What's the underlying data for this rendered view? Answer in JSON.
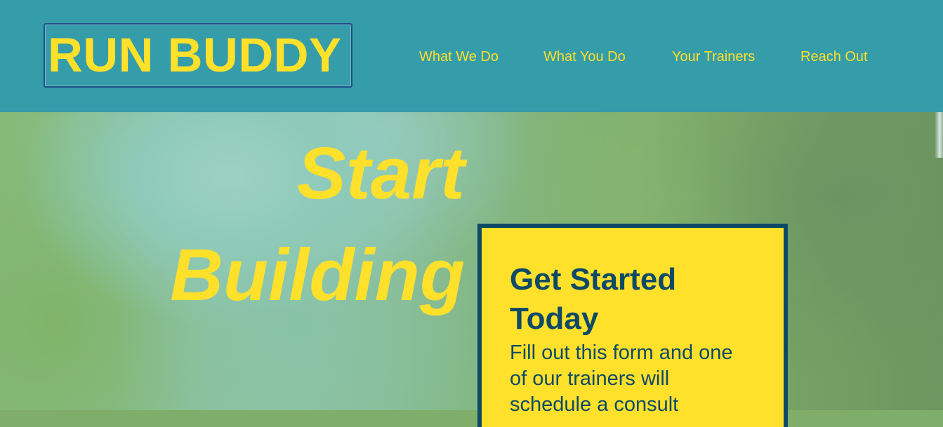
{
  "brand": {
    "logo_text": "RUN BUDDY"
  },
  "nav": {
    "items": [
      {
        "label": "What We Do"
      },
      {
        "label": "What You Do"
      },
      {
        "label": "Your Trainers"
      },
      {
        "label": "Reach Out"
      }
    ]
  },
  "hero": {
    "title_line1": "Start",
    "title_line2": "Building"
  },
  "signup_card": {
    "title": "Get Started Today",
    "text": "Fill out this form and one of our trainers will schedule a consult"
  },
  "colors": {
    "header_bg": "#359ca9",
    "accent_yellow": "#ffe02b",
    "navy": "#0e4a66"
  }
}
